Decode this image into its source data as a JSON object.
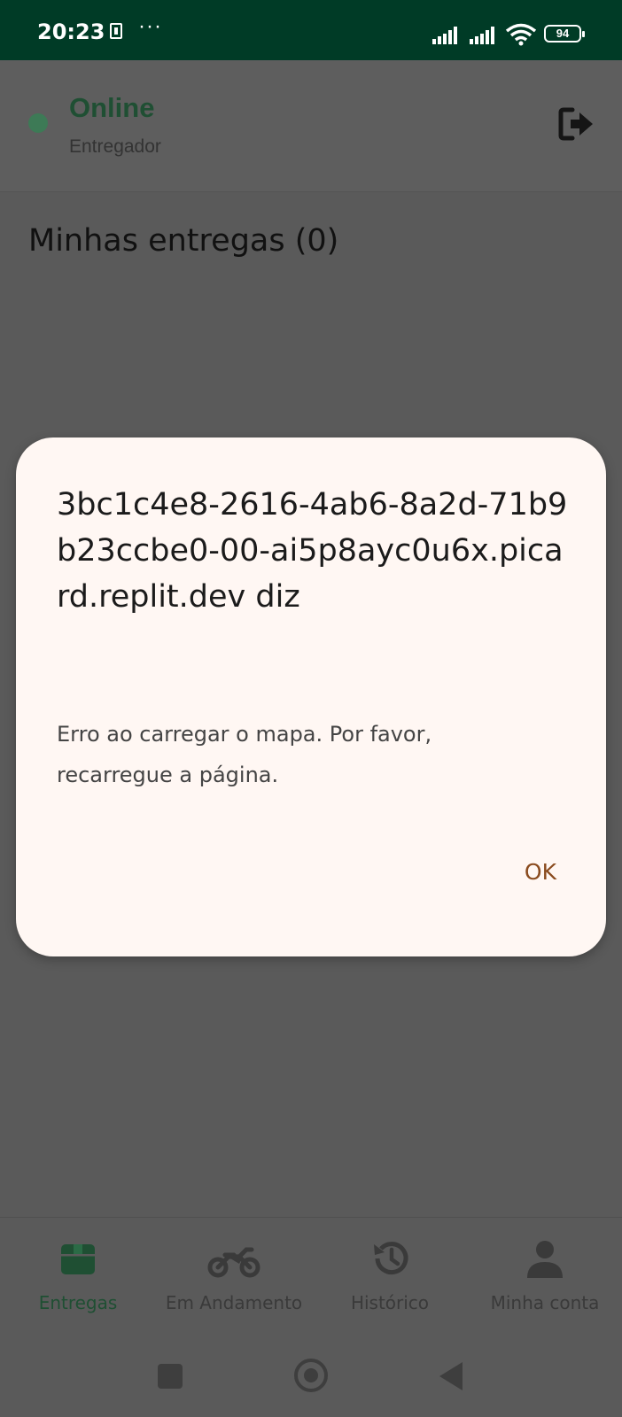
{
  "status_bar": {
    "time": "20:23",
    "more": "···",
    "battery": "94"
  },
  "header": {
    "status": "Online",
    "role": "Entregador"
  },
  "main": {
    "section_title": "Minhas entregas (0)"
  },
  "dialog": {
    "title": "3bc1c4e8-2616-4ab6-8a2d-71b9b23ccbe0-00-ai5p8ayc0u6x.picard.replit.dev diz",
    "message": "Erro ao carregar o mapa. Por favor, recarregue a página.",
    "ok_label": "OK"
  },
  "bottom_nav": {
    "items": [
      {
        "label": "Entregas",
        "icon": "package-icon",
        "active": true
      },
      {
        "label": "Em Andamento",
        "icon": "motorcycle-icon",
        "active": false
      },
      {
        "label": "Histórico",
        "icon": "history-icon",
        "active": false
      },
      {
        "label": "Minha conta",
        "icon": "person-icon",
        "active": false
      }
    ]
  },
  "colors": {
    "status_bar_bg": "#003b26",
    "accent_green": "#1f4f33",
    "dialog_bg": "#fff7f3",
    "ok_button": "#8a4b1e"
  }
}
